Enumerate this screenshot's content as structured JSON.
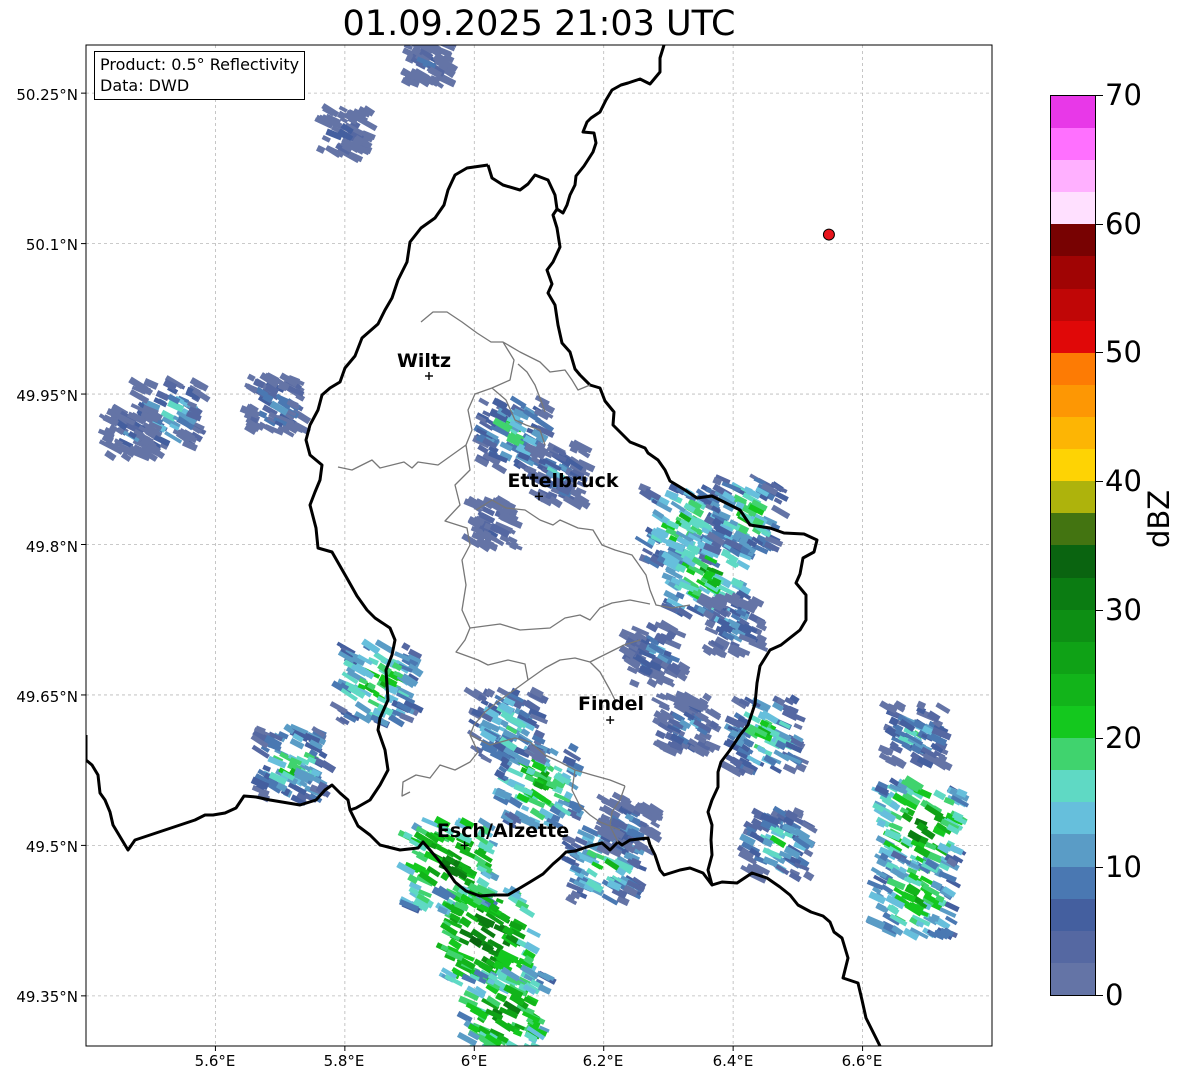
{
  "title": "01.09.2025 21:03 UTC",
  "info_box": {
    "line1": "Product: 0.5° Reflectivity",
    "line2": "Data: DWD"
  },
  "lat_labels": [
    "50.25°N",
    "50.1°N",
    "49.95°N",
    "49.8°N",
    "49.65°N",
    "49.5°N",
    "49.35°N"
  ],
  "lon_labels": [
    "5.6°E",
    "5.8°E",
    "6°E",
    "6.2°E",
    "6.4°E",
    "6.6°E"
  ],
  "cities": [
    {
      "name": "Wiltz",
      "lon": 5.93,
      "lat": 49.968
    },
    {
      "name": "Ettelbruck",
      "lon": 6.1,
      "lat": 49.848
    },
    {
      "name": "Findel",
      "lon": 6.21,
      "lat": 49.625
    },
    {
      "name": "Esch/Alzette",
      "lon": 5.985,
      "lat": 49.5
    }
  ],
  "radar_site": {
    "lon": 6.548,
    "lat": 50.109,
    "color": "#e8141c"
  },
  "colorbar": {
    "label": "dBZ",
    "min": 0,
    "max": 70,
    "tick_labels": [
      "0",
      "10",
      "20",
      "30",
      "40",
      "50",
      "60",
      "70"
    ],
    "colors": [
      "#6474a6",
      "#5568a2",
      "#445f9f",
      "#4a78b2",
      "#5a9cc6",
      "#66bfdc",
      "#5fd9c4",
      "#40d36e",
      "#14c81e",
      "#12b41a",
      "#0fa216",
      "#0d8f14",
      "#0b7c12",
      "#0a6410",
      "#437411",
      "#aeb30c",
      "#fed304",
      "#fdb504",
      "#fd9704",
      "#fd7b04",
      "#e00808",
      "#c00606",
      "#a00404",
      "#780202",
      "#ffe0ff",
      "#ffb0ff",
      "#ff70ff",
      "#e838e8"
    ]
  },
  "echoes": [
    {
      "lon": 5.93,
      "lat": 50.28,
      "dbz": 7
    },
    {
      "lon": 5.8,
      "lat": 50.21,
      "dbz": 9
    },
    {
      "lon": 5.53,
      "lat": 49.93,
      "dbz": 18
    },
    {
      "lon": 5.47,
      "lat": 49.91,
      "dbz": 10
    },
    {
      "lon": 5.69,
      "lat": 49.94,
      "dbz": 14
    },
    {
      "lon": 6.06,
      "lat": 49.91,
      "dbz": 20
    },
    {
      "lon": 6.03,
      "lat": 49.82,
      "dbz": 8
    },
    {
      "lon": 6.13,
      "lat": 49.87,
      "dbz": 14
    },
    {
      "lon": 6.32,
      "lat": 49.82,
      "dbz": 24
    },
    {
      "lon": 6.36,
      "lat": 49.77,
      "dbz": 26
    },
    {
      "lon": 6.4,
      "lat": 49.72,
      "dbz": 14
    },
    {
      "lon": 6.42,
      "lat": 49.83,
      "dbz": 22
    },
    {
      "lon": 6.28,
      "lat": 49.69,
      "dbz": 14
    },
    {
      "lon": 6.33,
      "lat": 49.62,
      "dbz": 14
    },
    {
      "lon": 6.45,
      "lat": 49.61,
      "dbz": 22
    },
    {
      "lon": 5.85,
      "lat": 49.66,
      "dbz": 25
    },
    {
      "lon": 5.72,
      "lat": 49.58,
      "dbz": 22
    },
    {
      "lon": 5.96,
      "lat": 49.48,
      "dbz": 32
    },
    {
      "lon": 6.02,
      "lat": 49.41,
      "dbz": 34
    },
    {
      "lon": 6.05,
      "lat": 49.33,
      "dbz": 30
    },
    {
      "lon": 6.1,
      "lat": 49.56,
      "dbz": 26
    },
    {
      "lon": 6.2,
      "lat": 49.48,
      "dbz": 22
    },
    {
      "lon": 6.24,
      "lat": 49.52,
      "dbz": 12
    },
    {
      "lon": 6.47,
      "lat": 49.5,
      "dbz": 20
    },
    {
      "lon": 6.68,
      "lat": 49.61,
      "dbz": 16
    },
    {
      "lon": 6.69,
      "lat": 49.52,
      "dbz": 30
    },
    {
      "lon": 6.68,
      "lat": 49.45,
      "dbz": 26
    },
    {
      "lon": 6.05,
      "lat": 49.62,
      "dbz": 20
    }
  ]
}
